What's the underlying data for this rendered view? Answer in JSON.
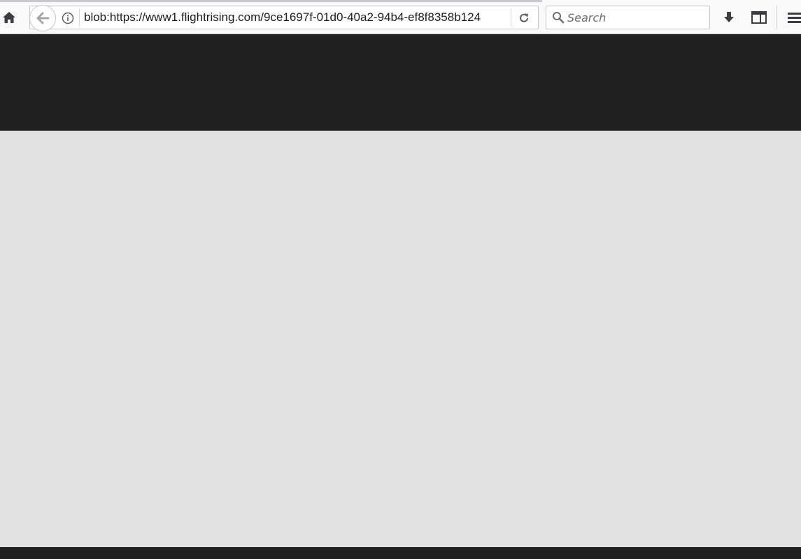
{
  "browser": {
    "url": "blob:https://www1.flightrising.com/9ce1697f-01d0-40a2-94b4-ef8f8358b124",
    "search_placeholder": "Search",
    "icons": {
      "home": "home-icon",
      "back": "back-arrow-icon",
      "info": "info-icon",
      "reload": "reload-icon",
      "search": "search-icon",
      "download": "download-icon",
      "sidebar": "sidebar-icon",
      "menu": "hamburger-menu-icon"
    }
  },
  "page": {
    "header_color": "#202020",
    "body_color": "#e1e1e1",
    "footer_color": "#1f1f1f"
  }
}
